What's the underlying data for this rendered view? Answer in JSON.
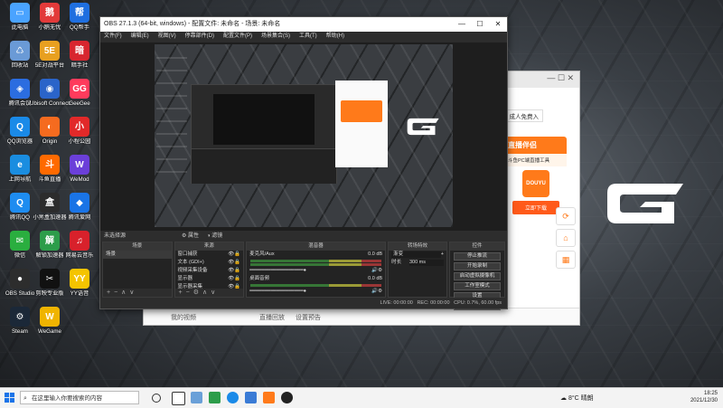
{
  "desktop": {
    "icons": [
      {
        "label": "此电脑",
        "color": "#4aa3ff",
        "glyph": "▭"
      },
      {
        "label": "小鹅无忧",
        "color": "#e23a3a",
        "glyph": "鹅"
      },
      {
        "label": "QQ帮手",
        "color": "#1f6fe0",
        "glyph": "帮"
      },
      {
        "label": "回收站",
        "color": "#6a9ad6",
        "glyph": "♺"
      },
      {
        "label": "5E对战平台",
        "color": "#e8a020",
        "glyph": "5E"
      },
      {
        "label": "暗手社",
        "color": "#d8262f",
        "glyph": "暗"
      },
      {
        "label": "腾讯会议",
        "color": "#2b6de0",
        "glyph": "◈"
      },
      {
        "label": "Ubisoft Connect",
        "color": "#2a64c9",
        "glyph": "◉"
      },
      {
        "label": "GeeGee",
        "color": "#ff3b5c",
        "glyph": "GG"
      },
      {
        "label": "QQ浏览器",
        "color": "#1a8ae8",
        "glyph": "Q"
      },
      {
        "label": "Origin",
        "color": "#f56b1f",
        "glyph": "◐"
      },
      {
        "label": "小程公园",
        "color": "#e22929",
        "glyph": "小"
      },
      {
        "label": "上网导航",
        "color": "#1a8de0",
        "glyph": "e"
      },
      {
        "label": "斗鱼直播",
        "color": "#ff6a00",
        "glyph": "斗"
      },
      {
        "label": "WeMod",
        "color": "#6b3fd9",
        "glyph": "W"
      },
      {
        "label": "腾讯QQ",
        "color": "#1e8cf0",
        "glyph": "Q"
      },
      {
        "label": "小黑盒加速器",
        "color": "#2c2c2c",
        "glyph": "盒"
      },
      {
        "label": "腾讯爱网",
        "color": "#1a74e6",
        "glyph": "◆"
      },
      {
        "label": "微信",
        "color": "#2aae3f",
        "glyph": "✉"
      },
      {
        "label": "解锁加速器",
        "color": "#2d9d4a",
        "glyph": "解"
      },
      {
        "label": "网易云音乐",
        "color": "#d8212b",
        "glyph": "♫"
      },
      {
        "label": "OBS Studio",
        "color": "#2d2d2d",
        "glyph": "●"
      },
      {
        "label": "剪映专业版",
        "color": "#111111",
        "glyph": "✂"
      },
      {
        "label": "YY语音",
        "color": "#f5c400",
        "glyph": "YY"
      },
      {
        "label": "Steam",
        "color": "#1b2838",
        "glyph": "⚙"
      },
      {
        "label": "WeGame",
        "color": "#f0b400",
        "glyph": "W"
      }
    ]
  },
  "browser": {
    "tab_title": "",
    "right_label": "成人免费入",
    "promo": {
      "title": "直播伴侣",
      "subtitle": "斗鱼PC端直播工具",
      "logo": "DOUYU",
      "download": "立即下载"
    },
    "footer": {
      "link1": "我的视频",
      "link2": "直播回放",
      "link3": "设置预告"
    }
  },
  "obs": {
    "title": "OBS 27.1.3 (64-bit, windows) - 配置文件: 未命名 - 场景: 未命名",
    "window_controls": {
      "min": "—",
      "max": "☐",
      "close": "✕"
    },
    "menu": [
      "文件(F)",
      "编辑(E)",
      "视图(V)",
      "停靠部件(D)",
      "配置文件(P)",
      "场景集合(S)",
      "工具(T)",
      "帮助(H)"
    ],
    "strip": {
      "label": "未选择源",
      "props": "属性",
      "filters": "滤镜"
    },
    "docks": {
      "scenes": {
        "header": "场景",
        "items": [
          "场景"
        ]
      },
      "sources": {
        "header": "来源",
        "items": [
          "窗口捕获",
          "文本 (GDI+)",
          "视频采集设备",
          "显示器",
          "显示器采集"
        ]
      },
      "mixer": {
        "header": "混音器",
        "tracks": [
          {
            "name": "麦克风/Aux",
            "level": "0.0 dB"
          },
          {
            "name": "桌面音频",
            "level": "0.0 dB"
          }
        ]
      },
      "transitions": {
        "header": "转场特效",
        "type": "渐变",
        "duration_label": "时长",
        "duration": "300 ms"
      },
      "controls": {
        "header": "控件",
        "buttons": [
          "停止推流",
          "开始录制",
          "启动虚拟摄像机",
          "工作室模式",
          "设置",
          "退出"
        ]
      }
    },
    "status": {
      "live": "LIVE: 00:00:00",
      "rec": "REC: 00:00:00",
      "cpu": "CPU: 0.7%, 60.00 fps"
    }
  },
  "taskbar": {
    "search_placeholder": "在这里输入你要搜索的内容",
    "weather": "8°C 晴朗",
    "time": "18:25",
    "date": "2021/12/30"
  },
  "colors": {
    "accent": "#ff7a1a",
    "obs_bg": "#2b2b2b",
    "taskbar": "#f3f3f3"
  }
}
